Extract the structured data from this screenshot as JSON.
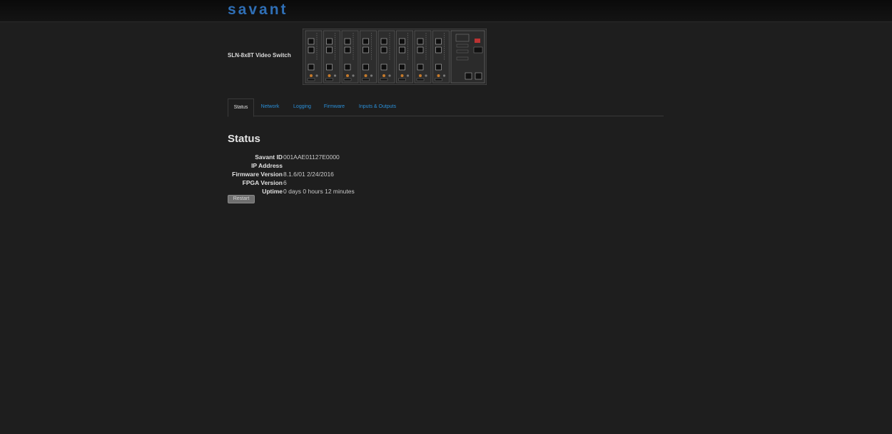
{
  "header": {
    "logo_text": "savant"
  },
  "device": {
    "name": "SLN-8x8T Video Switch"
  },
  "tabs": [
    {
      "label": "Status",
      "active": true
    },
    {
      "label": "Network",
      "active": false
    },
    {
      "label": "Logging",
      "active": false
    },
    {
      "label": "Firmware",
      "active": false
    },
    {
      "label": "Inputs & Outputs",
      "active": false
    }
  ],
  "status": {
    "title": "Status",
    "rows": [
      {
        "label": "Savant ID",
        "value": "001AAE01127E0000"
      },
      {
        "label": "IP Address",
        "value": ""
      },
      {
        "label": "Firmware Version",
        "value": "8.1.6/01 2/24/2016"
      },
      {
        "label": "FPGA Version",
        "value": "6"
      },
      {
        "label": "Uptime",
        "value": "0 days 0 hours 12 minutes"
      }
    ],
    "restart_label": "Restart"
  },
  "colors": {
    "background": "#1e1e1e",
    "accent": "#2a8fd8",
    "logo": "#2f6fb6"
  }
}
